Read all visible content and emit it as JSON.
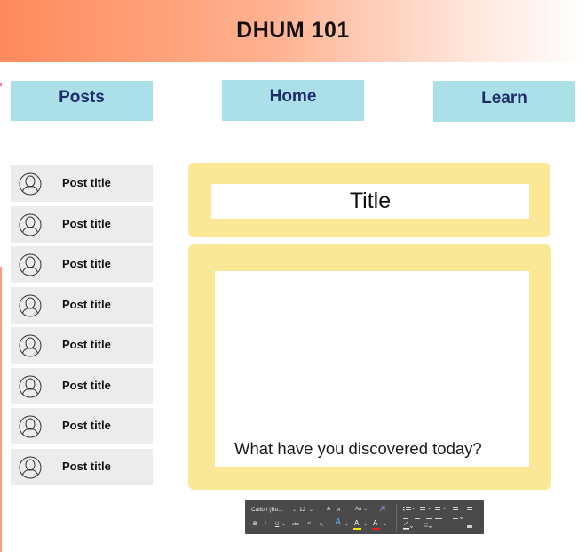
{
  "header": {
    "title": "DHUM 101"
  },
  "nav": {
    "posts": "Posts",
    "home": "Home",
    "learn": "Learn"
  },
  "posts": [
    {
      "title": "Post title"
    },
    {
      "title": "Post title"
    },
    {
      "title": "Post title"
    },
    {
      "title": "Post title"
    },
    {
      "title": "Post title"
    },
    {
      "title": "Post title"
    },
    {
      "title": "Post title"
    },
    {
      "title": "Post title"
    }
  ],
  "editor": {
    "title_value": "Title",
    "body_prompt": "What have you discovered today?"
  },
  "toolbar": {
    "font_name": "Calibri (Bo...",
    "font_size": "12",
    "bold": "B",
    "italic": "I",
    "underline": "U",
    "strike": "abc",
    "superscript": "x²",
    "subscript": "x₂",
    "grow_font": "A",
    "shrink_font": "A",
    "text_effects": "A",
    "highlight": "A",
    "font_color": "A"
  },
  "colors": {
    "nav_bg": "#abe0e8",
    "nav_text": "#1f2d6b",
    "card_bg": "#fae897",
    "post_bg": "#ececec",
    "header_gradient_start": "#ff8a5c"
  }
}
